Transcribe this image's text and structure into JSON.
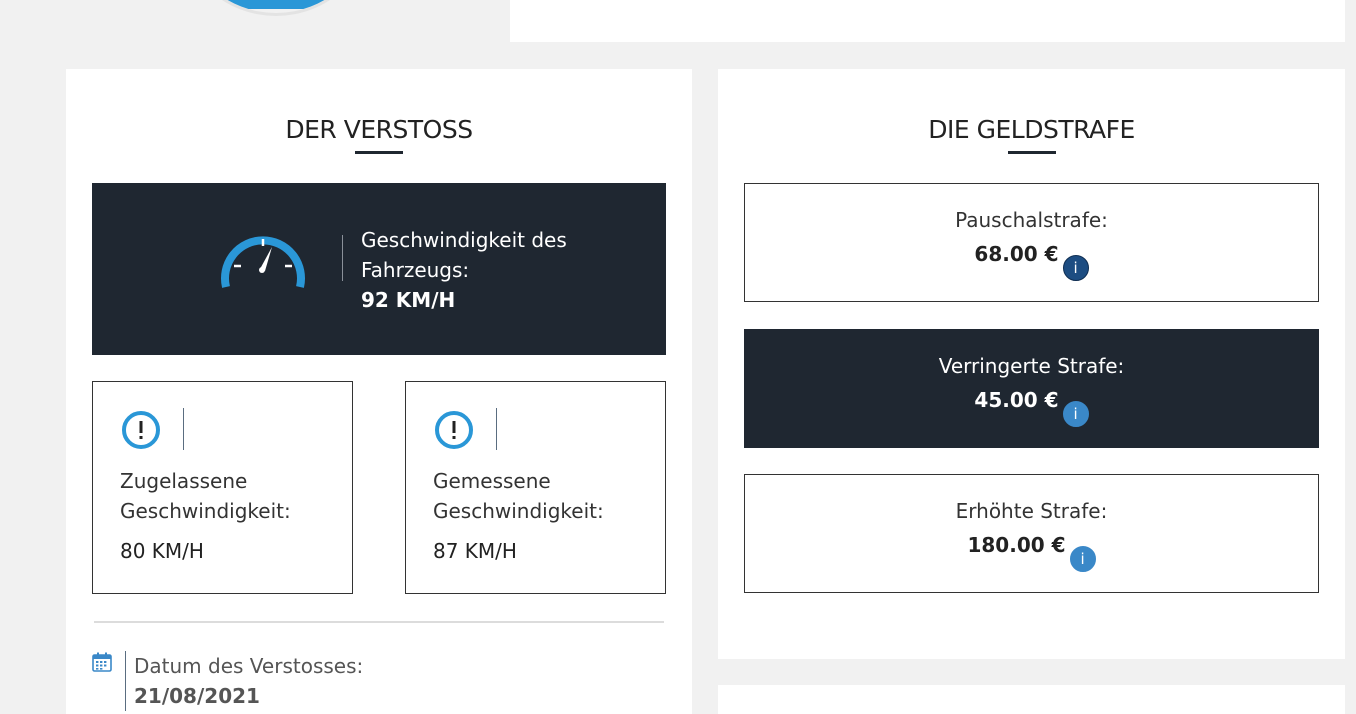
{
  "violation": {
    "title": "DER VERSTOSS",
    "banner": {
      "label_line1": "Geschwindigkeit des",
      "label_line2": "Fahrzeugs:",
      "value": "92 KM/H"
    },
    "allowed": {
      "label_line1": "Zugelassene",
      "label_line2": "Geschwindigkeit:",
      "value": "80 KM/H"
    },
    "measured": {
      "label_line1": "Gemessene",
      "label_line2": "Geschwindigkeit:",
      "value": "87 KM/H"
    },
    "date": {
      "label": "Datum des Verstosses:",
      "value": "21/08/2021"
    }
  },
  "fine": {
    "title": "DIE GELDSTRAFE",
    "items": [
      {
        "label": "Pauschalstrafe:",
        "value": "68.00 €",
        "info": "i"
      },
      {
        "label": "Verringerte Strafe:",
        "value": "45.00 €",
        "info": "i"
      },
      {
        "label": "Erhöhte Strafe:",
        "value": "180.00 €",
        "info": "i"
      }
    ]
  },
  "colors": {
    "dark": "#1f2731",
    "accent": "#2a97d7",
    "info_dark": "#1d4d82",
    "info_light": "#3a88c8"
  },
  "icons": {
    "gauge": "speedometer-icon",
    "warning": "exclamation-circle-icon",
    "calendar": "calendar-icon",
    "info": "info-icon"
  }
}
